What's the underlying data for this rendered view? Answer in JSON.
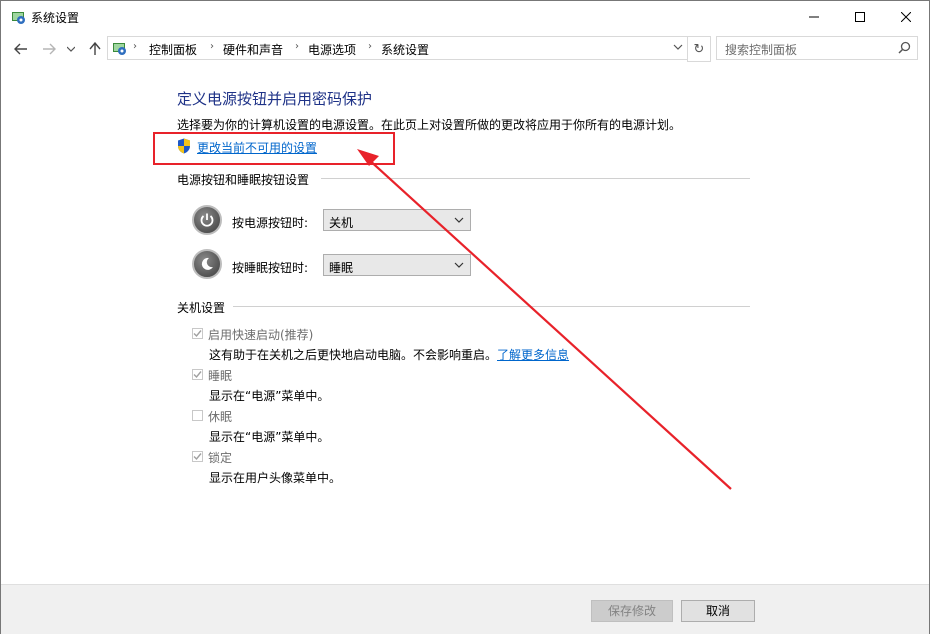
{
  "window": {
    "title": "系统设置"
  },
  "address": {
    "breadcrumbs": [
      "控制面板",
      "硬件和声音",
      "电源选项",
      "系统设置"
    ]
  },
  "search": {
    "placeholder": "搜索控制面板"
  },
  "main": {
    "heading": "定义电源按钮并启用密码保护",
    "description": "选择要为你的计算机设置的电源设置。在此页上对设置所做的更改将应用于你所有的电源计划。",
    "change_link": "更改当前不可用的设置"
  },
  "buttons_section": {
    "title": "电源按钮和睡眠按钮设置",
    "power_label": "按电源按钮时:",
    "power_value": "关机",
    "sleep_label": "按睡眠按钮时:",
    "sleep_value": "睡眠"
  },
  "shutdown_section": {
    "title": "关机设置",
    "items": [
      {
        "label": "启用快速启动(推荐)",
        "desc": "这有助于在关机之后更快地启动电脑。不会影响重启。",
        "link": "了解更多信息",
        "checked": true
      },
      {
        "label": "睡眠",
        "desc": "显示在“电源”菜单中。",
        "checked": true
      },
      {
        "label": "休眠",
        "desc": "显示在“电源”菜单中。",
        "checked": false
      },
      {
        "label": "锁定",
        "desc": "显示在用户头像菜单中。",
        "checked": true
      }
    ]
  },
  "footer": {
    "save_label": "保存修改",
    "cancel_label": "取消"
  },
  "colors": {
    "heading": "#1e3287",
    "link": "#0066cc",
    "annotation": "#e8222a"
  }
}
